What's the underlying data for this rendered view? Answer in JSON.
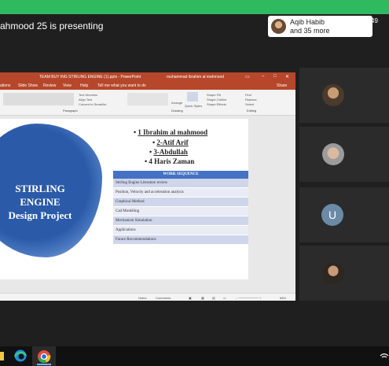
{
  "meeting": {
    "presenting_text": "ahmood 25 is presenting",
    "participants_line1": "Aqib Habib",
    "participants_line2": "and 35 more",
    "people_count": "49",
    "participant_initial": "U"
  },
  "powerpoint": {
    "window_title": "TEAM BUY ING STIRLING ENGINE (1).pptx  -  PowerPoint",
    "account": "muhammad ibrahim al mahmood",
    "tabs": [
      "ations",
      "Slide Show",
      "Review",
      "View",
      "Help",
      "Tell me what you want to do"
    ],
    "share_label": "Share",
    "ribbon": {
      "paragraph_label": "Paragraph",
      "drawing_label": "Drawing",
      "editing_label": "Editing",
      "text_direction": "Text Direction",
      "align_text": "Align Text",
      "convert_smartart": "Convert to SmartArt",
      "arrange": "Arrange",
      "quick_styles": "Quick Styles",
      "shape_fill": "Shape Fill",
      "shape_outline": "Shape Outline",
      "shape_effects": "Shape Effects",
      "find": "Find",
      "replace": "Replace",
      "select": "Select"
    },
    "status": {
      "notes": "Notes",
      "comments": "Comments",
      "zoom": "68%"
    }
  },
  "slide": {
    "title_lines": [
      "STIRLING",
      "ENGINE",
      "Design Project"
    ],
    "names": [
      "1 Ibrahim al mahmood",
      "2-Atif Arif",
      "3-Abdullah",
      "4 Haris Zaman"
    ],
    "work_sequence": {
      "header": "WORK SEQUENCE",
      "rows": [
        "Stirling Engine Literature review",
        "Position, Velocity and acceleration analysis",
        "Graphical Method",
        "Cad Modelling",
        "Mechanism Simulation",
        "Applications",
        "Future Recommendations"
      ]
    }
  },
  "colors": {
    "accent_green": "#2fba5f",
    "powerpoint_red": "#b7472a",
    "slide_blue": "#2a5aa8",
    "table_header": "#4472c4"
  },
  "taskbar_icons": [
    "file-explorer-icon",
    "edge-icon",
    "chrome-icon"
  ]
}
